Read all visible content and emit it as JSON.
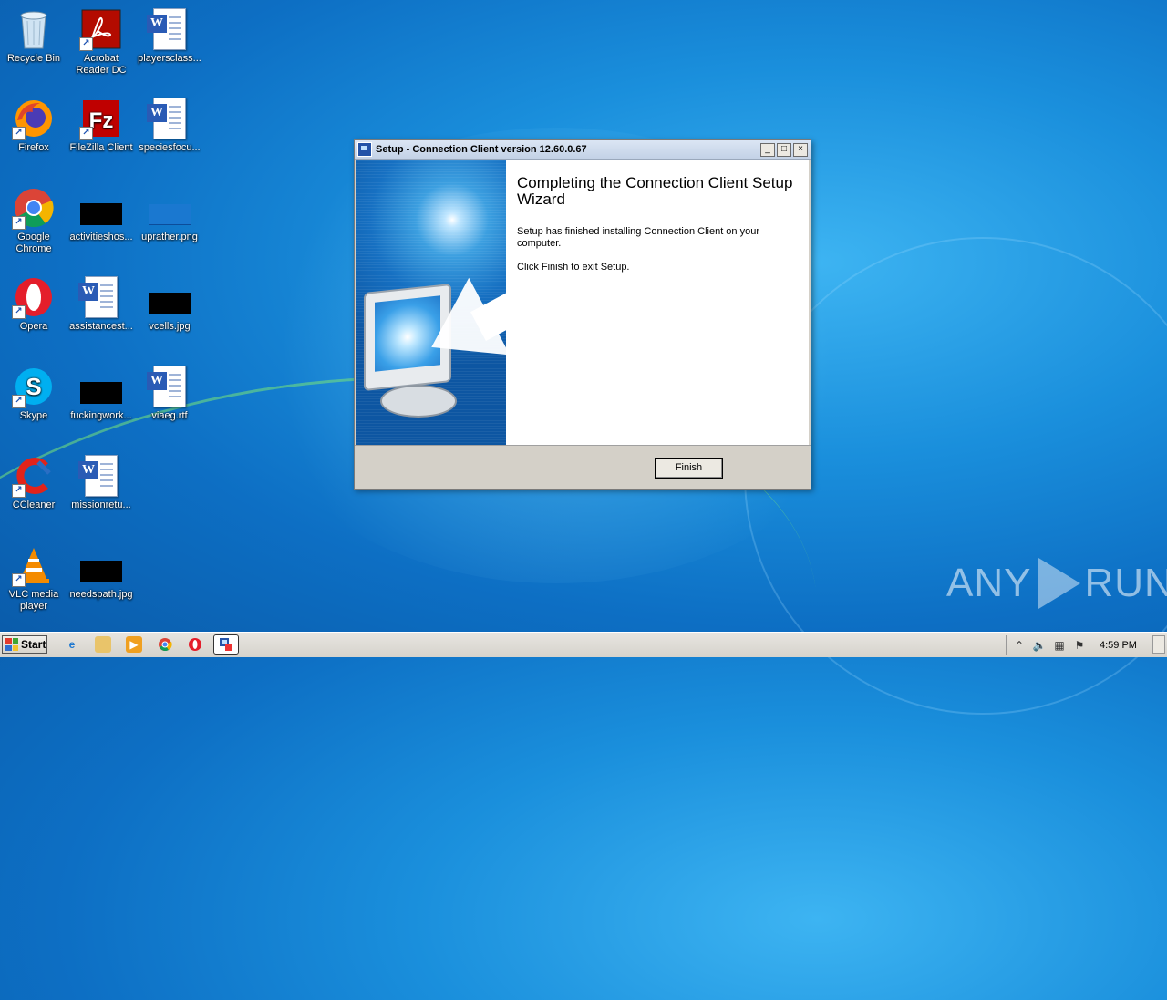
{
  "desktop": {
    "icons": [
      {
        "label": "Recycle Bin",
        "icon": "recycle-bin-icon"
      },
      {
        "label": "Acrobat Reader DC",
        "icon": "acrobat-icon"
      },
      {
        "label": "playersclass...",
        "icon": "word-document-icon"
      },
      {
        "label": "Firefox",
        "icon": "firefox-icon"
      },
      {
        "label": "FileZilla Client",
        "icon": "filezilla-icon"
      },
      {
        "label": "speciesfocu...",
        "icon": "word-document-icon"
      },
      {
        "label": "Google Chrome",
        "icon": "chrome-icon"
      },
      {
        "label": "activitieshos...",
        "icon": "image-thumbnail-icon"
      },
      {
        "label": "uprather.png",
        "icon": "image-thumbnail-icon"
      },
      {
        "label": "Opera",
        "icon": "opera-icon"
      },
      {
        "label": "assistancest...",
        "icon": "word-document-icon"
      },
      {
        "label": "vcells.jpg",
        "icon": "image-thumbnail-icon"
      },
      {
        "label": "Skype",
        "icon": "skype-icon"
      },
      {
        "label": "fuckingwork...",
        "icon": "image-thumbnail-icon"
      },
      {
        "label": "viaeg.rtf",
        "icon": "word-document-icon"
      },
      {
        "label": "CCleaner",
        "icon": "ccleaner-icon"
      },
      {
        "label": "missionretu...",
        "icon": "word-document-icon"
      },
      {
        "label": "VLC media player",
        "icon": "vlc-icon"
      },
      {
        "label": "needspath.jpg",
        "icon": "image-thumbnail-icon"
      }
    ]
  },
  "window": {
    "title": "Setup - Connection Client version 12.60.0.67",
    "controls": {
      "minimize": "_",
      "maximize": "□",
      "close": "×"
    },
    "heading": "Completing the Connection Client Setup Wizard",
    "message1": "Setup has finished installing Connection Client on your computer.",
    "message2": "Click Finish to exit Setup.",
    "finish_label": "Finish"
  },
  "watermark": {
    "left": "ANY",
    "right": "RUN"
  },
  "taskbar": {
    "start_label": "Start",
    "pinned": [
      "internet-explorer-icon",
      "file-explorer-icon",
      "media-player-icon",
      "chrome-icon",
      "opera-icon",
      "setup-app-icon"
    ],
    "clock": "4:59 PM"
  },
  "colors": {
    "desktop_blue": "#1a8fdc",
    "titlebar": "#c3d2e6",
    "dialog_gray": "#d4d0c8"
  }
}
